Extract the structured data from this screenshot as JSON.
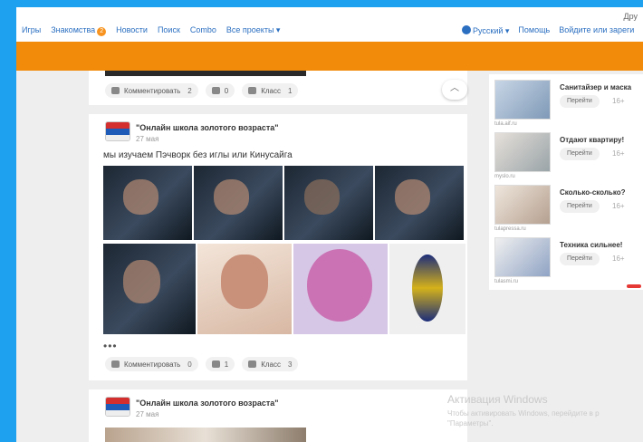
{
  "topbar": {
    "corner_text": "Дру",
    "nav": [
      {
        "label": "Игры"
      },
      {
        "label": "Знакомства",
        "badge": "2"
      },
      {
        "label": "Новости"
      },
      {
        "label": "Поиск"
      },
      {
        "label": "Combo"
      },
      {
        "label": "Все проекты ▾"
      }
    ],
    "language": "Русский ▾",
    "help": "Помощь",
    "login": "Войдите",
    "or": "или",
    "register": "зареги"
  },
  "posts": [
    {
      "actions": {
        "comment_label": "Комментировать",
        "comment_count": "2",
        "share_count": "0",
        "like_label": "Класс",
        "like_count": "1"
      }
    },
    {
      "author": "\"Онлайн школа золотого возраста\"",
      "date": "27 мая",
      "text": "мы изучаем Пэчворк без иглы или Кинусайга",
      "more": "•••",
      "actions": {
        "comment_label": "Комментировать",
        "comment_count": "0",
        "share_count": "1",
        "like_label": "Класс",
        "like_count": "3"
      }
    },
    {
      "author": "\"Онлайн школа золотого возраста\"",
      "date": "27 мая"
    }
  ],
  "sidebar_ads": [
    {
      "title": "Санитайзер и маска",
      "go": "Перейти",
      "age": "16+",
      "source": "tula.aif.ru"
    },
    {
      "title": "Отдают квартиру!",
      "go": "Перейти",
      "age": "16+",
      "source": "myslo.ru"
    },
    {
      "title": "Сколько-сколько?",
      "go": "Перейти",
      "age": "16+",
      "source": "tulapressa.ru"
    },
    {
      "title": "Техника сильнее!",
      "go": "Перейти",
      "age": "16+",
      "source": "tulasmi.ru"
    }
  ],
  "watermark": {
    "title": "Активация Windows",
    "text": "Чтобы активировать Windows, перейдите в р \"Параметры\"."
  },
  "colors": {
    "frame": "#1ea2f0",
    "header_orange": "#f38b0a",
    "link_blue": "#2b6fc1"
  }
}
